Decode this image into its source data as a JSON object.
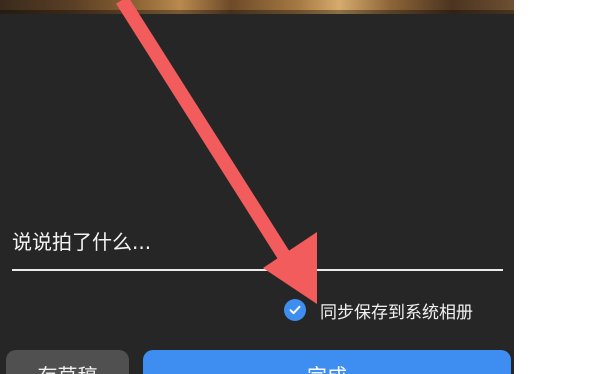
{
  "caption": {
    "placeholder": "说说拍了什么..."
  },
  "sync_option": {
    "label": "同步保存到系统相册",
    "checked": true
  },
  "buttons": {
    "save_draft": "存草稿",
    "done": "完成"
  },
  "colors": {
    "panel_background": "#262626",
    "accent_blue": "#3d8ef0",
    "arrow_red": "#f25c5c",
    "draft_button_background": "#505050"
  },
  "icons": {
    "checkbox": "check-circle-icon",
    "annotation": "red-arrow-icon"
  }
}
